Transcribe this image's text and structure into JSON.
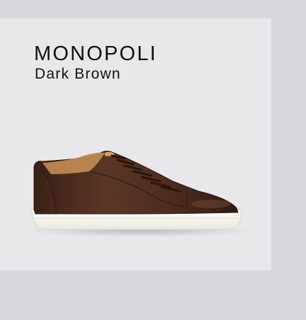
{
  "product": {
    "name": "MONOPOLI",
    "color": "Dark Brown",
    "image": {
      "icon": "leather-sneaker-icon",
      "leather_color": "#4a2c1e",
      "sole_color": "#f4f2ec"
    }
  }
}
